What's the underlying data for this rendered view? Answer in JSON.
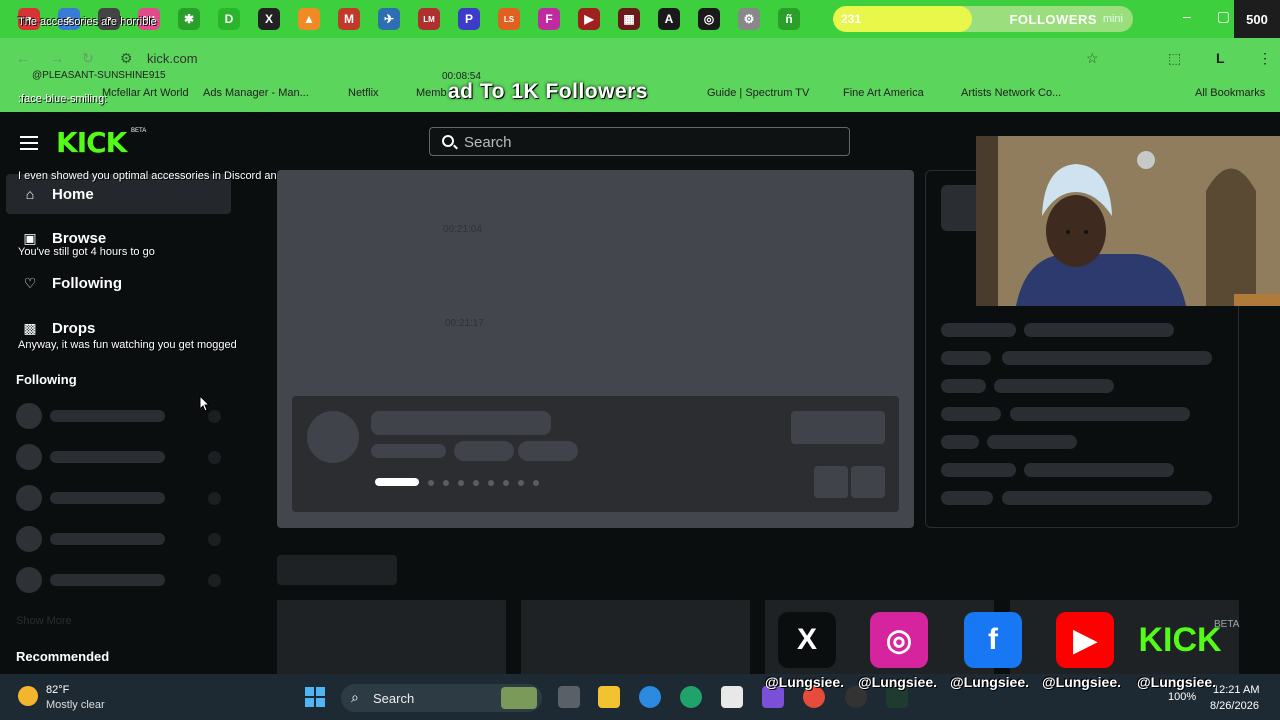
{
  "browser": {
    "tab_overlay_text": "The accessories are horrible",
    "url": "kick.com",
    "window_controls": [
      "–",
      "▢",
      "✕"
    ],
    "tab_icons": [
      {
        "name": "tab-favicon-1",
        "color": "#d63434",
        "glyph": "●"
      },
      {
        "name": "tab-favicon-2",
        "color": "#3a7bd5",
        "glyph": "●"
      },
      {
        "name": "tab-favicon-3",
        "color": "#444444",
        "glyph": "●"
      },
      {
        "name": "tab-favicon-4",
        "color": "#e04b8a",
        "glyph": "661"
      },
      {
        "name": "tab-favicon-5",
        "color": "#2aa02a",
        "glyph": "✱"
      },
      {
        "name": "tab-favicon-6",
        "color": "#2bb52b",
        "glyph": "D"
      },
      {
        "name": "tab-favicon-7",
        "color": "#222222",
        "glyph": "X"
      },
      {
        "name": "tab-favicon-8",
        "color": "#f08a24",
        "glyph": "▲"
      },
      {
        "name": "tab-favicon-9",
        "color": "#c0392b",
        "glyph": "M"
      },
      {
        "name": "tab-favicon-10",
        "color": "#2d6fb0",
        "glyph": "✈"
      },
      {
        "name": "tab-favicon-11",
        "color": "#b03030",
        "glyph": "LM"
      },
      {
        "name": "tab-favicon-12",
        "color": "#3c3cc8",
        "glyph": "P"
      },
      {
        "name": "tab-favicon-13",
        "color": "#e06020",
        "glyph": "LS"
      },
      {
        "name": "tab-favicon-14",
        "color": "#c02aa0",
        "glyph": "F"
      },
      {
        "name": "tab-favicon-15",
        "color": "#a02020",
        "glyph": "▶"
      },
      {
        "name": "tab-favicon-16",
        "color": "#6a1a1a",
        "glyph": "▦"
      },
      {
        "name": "tab-favicon-17",
        "color": "#1a1a1a",
        "glyph": "A"
      },
      {
        "name": "tab-favicon-18",
        "color": "#1a1a1a",
        "glyph": "◎"
      },
      {
        "name": "tab-favicon-19",
        "color": "#888888",
        "glyph": "⚙"
      },
      {
        "name": "tab-favicon-20",
        "color": "#2aa02a",
        "glyph": "ñ"
      }
    ],
    "bookmarks": [
      {
        "label": "Mcfellar Art World"
      },
      {
        "label": "Ads Manager - Man..."
      },
      {
        "label": "Netflix"
      },
      {
        "label": "Memb"
      },
      {
        "label": "Guide | Spectrum TV"
      },
      {
        "label": "Fine Art America"
      },
      {
        "label": "Artists Network Co..."
      },
      {
        "label": "All Bookmarks"
      }
    ]
  },
  "stream_overlay": {
    "follower_count": "231",
    "follower_goal": "500",
    "follower_progress": 0.462,
    "followers_label": "FOLLOWERS",
    "gemini_label": "mini",
    "handle_top": "@PLEASANT-SUNSHINE915",
    "timer_top": "00:08:54",
    "ticker": "ad To 1K Followers",
    "bookmark_overlay": ":face-blue-smiling:",
    "chat_messages": [
      "I even showed you optimal accessories in Discord and you ignored it",
      "You've still got 4 hours to go",
      "Anyway, it was fun watching you get mogged"
    ],
    "ghost_timestamps": [
      "00:21:04",
      "00:21:17"
    ],
    "handles": [
      "@Lungsiee.",
      "@Lungsiee.",
      "@Lungsiee.",
      "@Lungsiee.",
      "@Lungsiee."
    ],
    "socials": [
      {
        "name": "x-icon",
        "glyph": "X",
        "bg": "#0b0e0f",
        "fg": "#ffffff"
      },
      {
        "name": "instagram-icon",
        "glyph": "◎",
        "bg": "#d6249f",
        "fg": "#ffffff"
      },
      {
        "name": "facebook-icon",
        "glyph": "f",
        "bg": "#1877f2",
        "fg": "#ffffff"
      },
      {
        "name": "youtube-icon",
        "glyph": "▶",
        "bg": "#ff0000",
        "fg": "#ffffff"
      },
      {
        "name": "kick-icon",
        "glyph": "KICK",
        "bg": "transparent",
        "fg": "#53fc18"
      }
    ],
    "kick_beta": "BETA"
  },
  "kick": {
    "logo": "KICK",
    "beta": "BETA",
    "search_placeholder": "Search",
    "nav": [
      {
        "label": "Home",
        "icon": "⌂"
      },
      {
        "label": "Browse",
        "icon": "▣"
      },
      {
        "label": "Following",
        "icon": "♡"
      },
      {
        "label": "Drops",
        "icon": "▩"
      }
    ],
    "following_header": "Following",
    "show_more": "Show More",
    "recommended_header": "Recommended"
  },
  "taskbar": {
    "temperature": "82°F",
    "weather": "Mostly clear",
    "search_label": "Search",
    "battery": "100%",
    "time": "12:21 AM",
    "date": "8/26/2026"
  },
  "colors": {
    "accent": "#53fc18",
    "chrome_green": "#3ecf3e",
    "page_bg": "#0b0e0f"
  }
}
